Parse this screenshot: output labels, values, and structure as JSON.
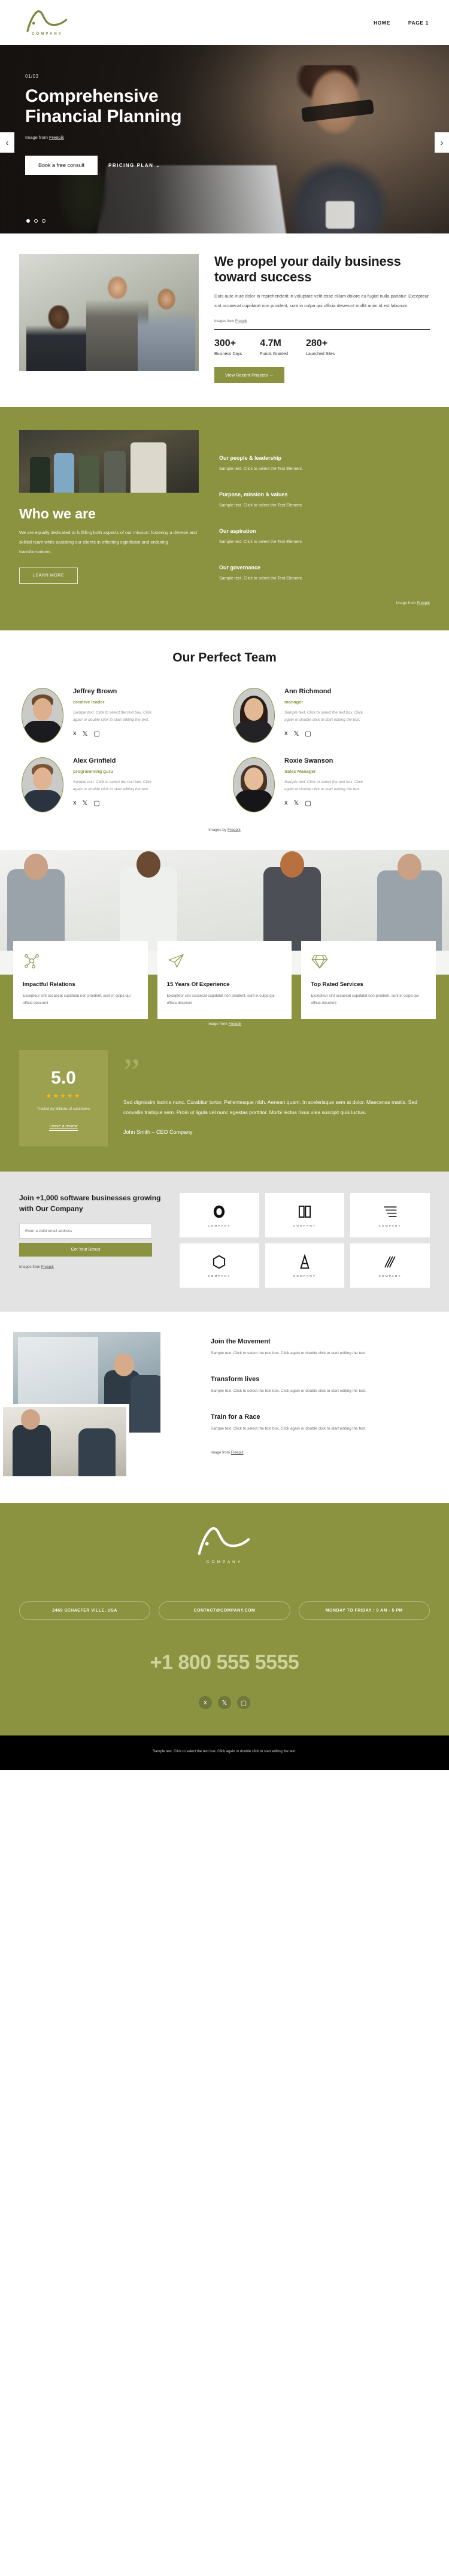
{
  "header": {
    "logo_alt": "company-logo",
    "logo_word": "COMPANY",
    "nav": [
      {
        "label": "HOME"
      },
      {
        "label": "PAGE 1"
      }
    ]
  },
  "hero": {
    "counter": "01/03",
    "title_line1": "Comprehensive",
    "title_line2": "Financial Planning",
    "credit_prefix": "Image from ",
    "credit_link": "Freepik",
    "primary_button": "Book a free consult",
    "secondary_button": "PRICING PLAN",
    "secondary_caret": "⌄",
    "prev_arrow": "‹",
    "next_arrow": "›",
    "slides": 3,
    "active_slide": 1
  },
  "propel": {
    "heading": "We propel your daily business toward success",
    "paragraph": "Duis aute irure dolor in reprehenderit in voluptate velit esse cillum dolore eu fugiat nulla pariatur. Excepteur sint occaecat cupidatat non proident, sunt in culpa qui officia deserunt mollit anim id est laborum.",
    "credit_prefix": "Images from ",
    "credit_link": "Freepik",
    "stats": [
      {
        "number": "300+",
        "label": "Business Days"
      },
      {
        "number": "4.7M",
        "label": "Funds Granted"
      },
      {
        "number": "280+",
        "label": "Launched Sites"
      }
    ],
    "cta": "View Recent Projects  →"
  },
  "who": {
    "heading": "Who we are",
    "paragraph": "We are equally dedicated to fulfilling both aspects of our mission: fostering a diverse and skilled team while assisting our clients in effecting significant and enduring transformations.",
    "button": "LEARN MORE",
    "items": [
      {
        "title": "Our people & leadership",
        "text": "Sample text. Click to select the Text Element."
      },
      {
        "title": "Purpose, mission & values",
        "text": "Sample text. Click to select the Text Element."
      },
      {
        "title": "Our aspiration",
        "text": "Sample text. Click to select the Text Element."
      },
      {
        "title": "Our governance",
        "text": "Sample text. Click to select the Text Element."
      }
    ],
    "credit_prefix": "Image from ",
    "credit_link": "Freepik"
  },
  "team": {
    "heading": "Our Perfect Team",
    "members": [
      {
        "name": "Jeffrey Brown",
        "role": "creative leader",
        "desc": "Sample text. Click to select the text box. Click again or double click to start editing the text."
      },
      {
        "name": "Ann Richmond",
        "role": "manager",
        "desc": "Sample text. Click to select the text box. Click again or double click to start editing the text."
      },
      {
        "name": "Alex Grinfield",
        "role": "programming guru",
        "desc": "Sample text. Click to select the text box. Click again or double click to start editing the text."
      },
      {
        "name": "Roxie Swanson",
        "role": "Sales Manager",
        "desc": "Sample text. Click to select the text box. Click again or double click to start editing the text."
      }
    ],
    "social": [
      "facebook-icon",
      "x-icon",
      "instagram-icon"
    ],
    "credit_prefix": "Images by ",
    "credit_link": "Freepik"
  },
  "features": {
    "cards": [
      {
        "icon": "network-nodes-icon",
        "title": "Impactful Relations",
        "desc": "Excepteur sint occaecat cupidatat non proident, sunt in culpa qui officia deserunt"
      },
      {
        "icon": "paper-plane-icon",
        "title": "15 Years Of Experience",
        "desc": "Excepteur sint occaecat cupidatat non proident, sunt in culpa qui officia deserunt"
      },
      {
        "icon": "diamond-icon",
        "title": "Top Rated Services",
        "desc": "Excepteur sint occaecat cupidatat non proident, sunt in culpa qui officia deserunt"
      }
    ],
    "credit_prefix": "Image from ",
    "credit_link": "Freepik"
  },
  "testimonial": {
    "rating": "5.0",
    "stars": "★★★★★",
    "trusted": "Trusted by Millions of customers",
    "review_link": "Leave a review",
    "quote_mark": "”",
    "quote": "Sed dignissim lacinia nunc. Curabitur tortor. Pellentesque nibh. Aenean quam. In scelerisque sem at dolor. Maecenas mattis. Sed convallis tristique sem. Proin ut ligula vel nunc egestas porttitor. Morbi lectus risus ulea suscipit quis luctus.",
    "author": "John Smith – CEO Company"
  },
  "newsletter": {
    "heading": "Join +1,000 software businesses growing with Our Company",
    "input_placeholder": "Enter a valid email address",
    "button": "Get Your Bonus",
    "credit_prefix": "Images from ",
    "credit_link": "Freepik",
    "logos": [
      {
        "icon": "ring-logo-icon",
        "label": "COMPANY"
      },
      {
        "icon": "book-logo-icon",
        "label": "COMPANY"
      },
      {
        "icon": "stripes-logo-icon",
        "label": "COMPANY"
      },
      {
        "icon": "hexagon-logo-icon",
        "label": "COMPANY"
      },
      {
        "icon": "tower-logo-icon",
        "label": "COMPANY"
      },
      {
        "icon": "lines-logo-icon",
        "label": "COMPANY"
      }
    ]
  },
  "movement": {
    "items": [
      {
        "title": "Join the Movement",
        "text": "Sample text. Click to select the text box. Click again or double click to start editing the text."
      },
      {
        "title": "Transform lives",
        "text": "Sample text. Click to select the text box. Click again or double click to start editing the text."
      },
      {
        "title": "Train for a Race",
        "text": "Sample text. Click to select the text box. Click again or double click to start editing the text."
      }
    ],
    "credit_prefix": "Image from ",
    "credit_link": "Freepik"
  },
  "footer": {
    "logo_alt": "company-logo-footer",
    "logo_word": "COMPANY",
    "pills": [
      {
        "label": "2469 SCHAEFER VILLE, USA"
      },
      {
        "label": "CONTACT@COMPANY.COM"
      },
      {
        "label": "MONDAY TO FRIDAY : 9 AM - 5 PM"
      }
    ],
    "phone": "+1 800 555 5555",
    "social": [
      "facebook-icon",
      "x-icon",
      "instagram-icon"
    ],
    "bottom_text": "Sample text. Click to select the text box. Click again or double click to start editing the text."
  },
  "colors": {
    "olive": "#8b9341",
    "olive_light": "#9ba14f",
    "phone_text": "#cdd39a",
    "star": "#fdb515"
  }
}
